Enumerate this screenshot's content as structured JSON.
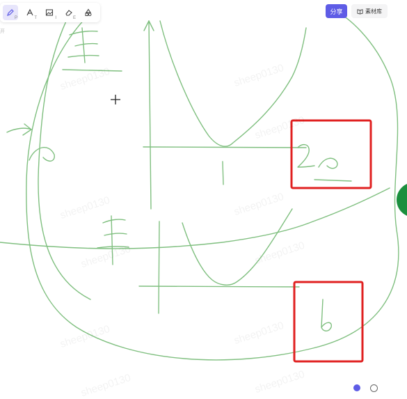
{
  "toolbar": {
    "tools": [
      {
        "name": "pen-icon",
        "key": "P"
      },
      {
        "name": "text-icon",
        "key": "T"
      },
      {
        "name": "image-icon",
        "key": "I"
      },
      {
        "name": "eraser-icon",
        "key": "E"
      },
      {
        "name": "shapes-icon",
        "key": ""
      }
    ]
  },
  "side_label": "开",
  "header": {
    "share_label": "分享",
    "material_label": "素材库"
  },
  "watermark_text": "sheep0130",
  "colors": {
    "ink": "#7fbf7f",
    "accent": "#5e5ce6",
    "highlight_box": "#e02020",
    "side_tab": "#1b8f3e"
  }
}
